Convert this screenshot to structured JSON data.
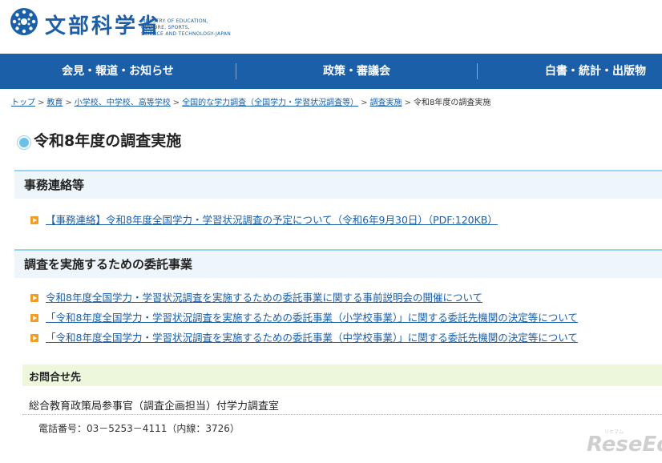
{
  "header": {
    "logo_jp": "文部科学省",
    "logo_en_lines": [
      "MINISTRY OF EDUCATION,",
      "CULTURE, SPORTS,",
      "SCIENCE AND TECHNOLOGY-JAPAN"
    ]
  },
  "nav": {
    "items": [
      "会見・報道・お知らせ",
      "政策・審議会",
      "白書・統計・出版物"
    ]
  },
  "breadcrumb": {
    "links": [
      "トップ",
      "教育",
      "小学校、中学校、高等学校",
      "全国的な学力調査（全国学力・学習状況調査等）",
      "調査実施"
    ],
    "current": "令和8年度の調査実施"
  },
  "page": {
    "title": "令和8年度の調査実施"
  },
  "sections": [
    {
      "heading": "事務連絡等",
      "links": [
        "【事務連絡】令和8年度全国学力・学習状況調査の予定について（令和6年9月30日）（PDF:120KB）"
      ]
    },
    {
      "heading": "調査を実施するための委託事業",
      "links": [
        "令和8年度全国学力・学習状況調査を実施するための委託事業に関する事前説明会の開催について",
        "「令和8年度全国学力・学習状況調査を実施するための委託事業（小学校事業）」に関する委託先機関の決定等について",
        "「令和8年度全国学力・学習状況調査を実施するための委託事業（中学校事業）」に関する委託先機関の決定等について"
      ]
    }
  ],
  "contact": {
    "heading": "お問合せ先",
    "org": "総合教育政策局参事官（調査企画担当）付学力調査室",
    "tel": "電話番号：03－5253－4111（内線：3726）"
  },
  "watermark": {
    "text": "ReseEd",
    "small": "リセマム"
  },
  "colors": {
    "brand_blue": "#1a5fa8",
    "link_blue": "#1a5fa8",
    "bullet_orange": "#f39c24",
    "section_bg": "#eef6fb",
    "contact_bg": "#edf7dc"
  }
}
